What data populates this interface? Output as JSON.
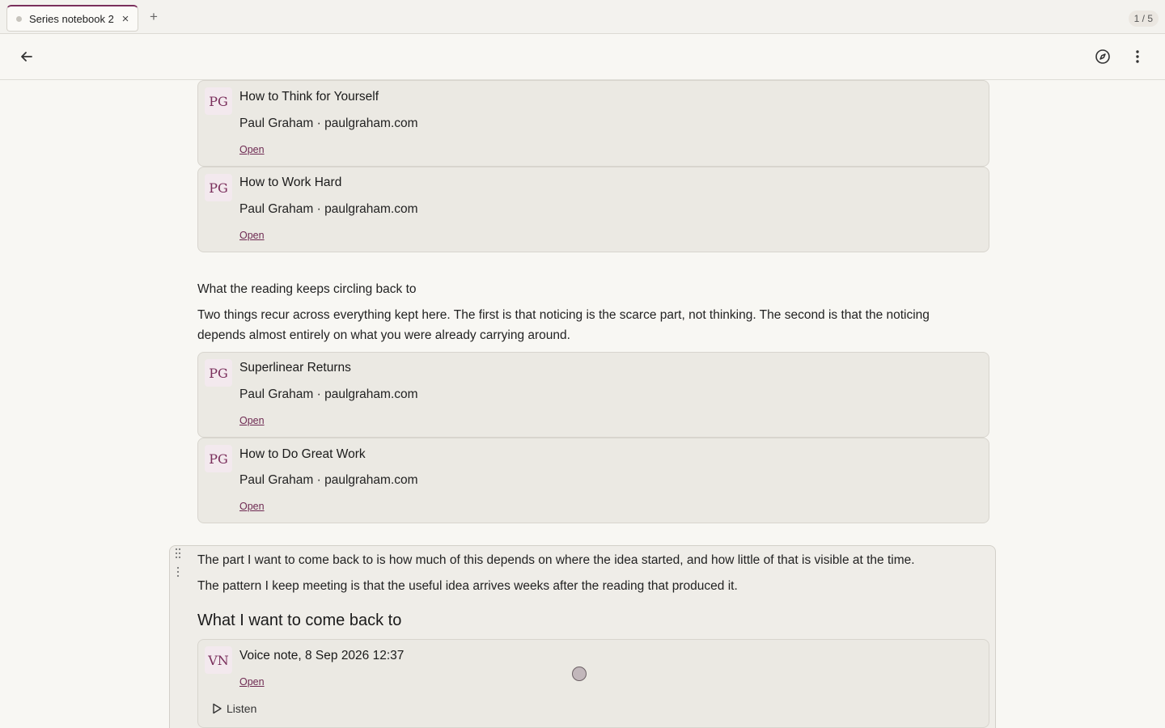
{
  "tabs": [
    {
      "title": "Series notebook 2",
      "close": "×"
    }
  ],
  "tab_add": "+",
  "page_count": "1 / 5",
  "toolbar": {
    "back_icon": "arrow-left-icon",
    "compass_icon": "compass-icon",
    "more_icon": "more-vertical-icon"
  },
  "cards_top": [
    {
      "avatar": "PG",
      "title": "How to Think for Yourself",
      "meta": "Paul Graham · paulgraham.com",
      "open": "Open"
    },
    {
      "avatar": "PG",
      "title": "How to Work Hard",
      "meta": "Paul Graham · paulgraham.com",
      "open": "Open"
    }
  ],
  "section1": {
    "heading": "What the reading keeps circling back to",
    "body": "Two things recur across everything kept here. The first is that noticing is the scarce part, not thinking. The second is that the noticing depends almost entirely on what you were already carrying around."
  },
  "cards_mid": [
    {
      "avatar": "PG",
      "title": "Superlinear Returns",
      "meta": "Paul Graham · paulgraham.com",
      "open": "Open"
    },
    {
      "avatar": "PG",
      "title": "How to Do Great Work",
      "meta": "Paul Graham · paulgraham.com",
      "open": "Open"
    }
  ],
  "section2": {
    "p1": "The part I want to come back to is how much of this depends on where the idea started, and how little of that is visible at the time.",
    "p2": "The pattern I keep meeting is that the useful idea arrives weeks after the reading that produced it.",
    "heading": "What I want to come back to"
  },
  "voice_card": {
    "avatar": "VN",
    "title": "Voice note, 8 Sep 2026 12:37",
    "open": "Open",
    "listen": "Listen"
  },
  "colors": {
    "accent": "#7a2f5c",
    "card_bg": "#ebe9e3",
    "page_bg": "#f8f7f3"
  }
}
